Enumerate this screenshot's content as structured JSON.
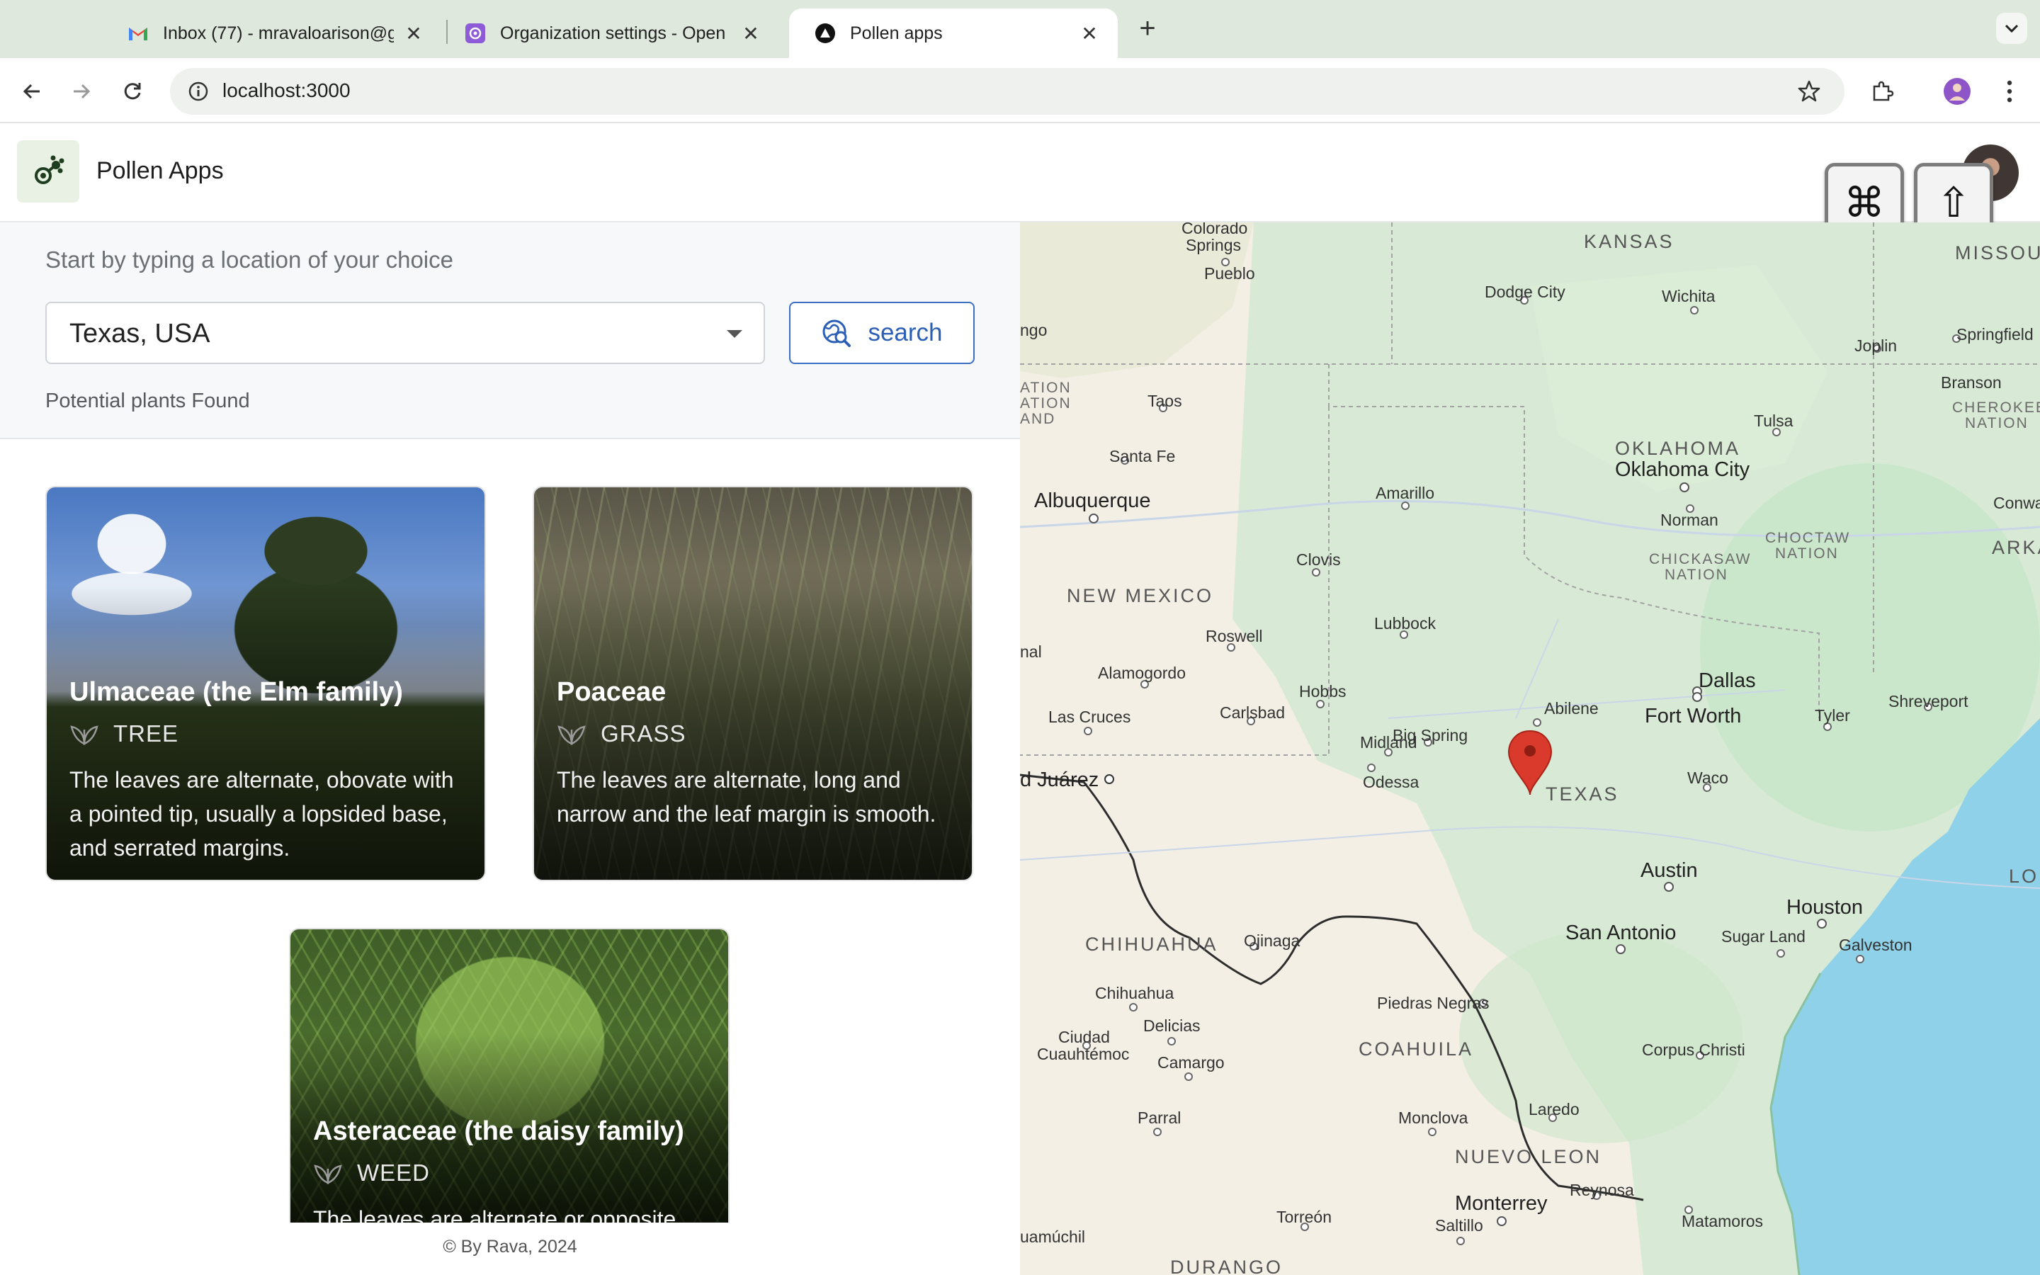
{
  "browser": {
    "tabs": [
      {
        "title": "Inbox (77) - mravaloarison@g",
        "icon": "gmail-icon"
      },
      {
        "title": "Organization settings - Open",
        "icon": "openai-icon"
      },
      {
        "title": "Pollen apps",
        "icon": "app-triangle-icon",
        "active": true
      }
    ],
    "url": "localhost:3000"
  },
  "app": {
    "name": "Pollen Apps",
    "keycaps": [
      "⌘",
      "⇧"
    ]
  },
  "search": {
    "prompt": "Start by typing a location of your choice",
    "location": "Texas, USA",
    "button_label": "search",
    "results_label": "Potential plants Found"
  },
  "plants": [
    {
      "name": "Ulmaceae (the Elm family)",
      "type": "TREE",
      "description": "The leaves are alternate, obovate with a pointed tip, usually a lopsided base, and serrated margins."
    },
    {
      "name": "Poaceae",
      "type": "GRASS",
      "description": "The leaves are alternate, long and narrow and the leaf margin is smooth."
    },
    {
      "name": "Asteraceae (the daisy family)",
      "type": "WEED",
      "description": "The leaves are alternate or opposite,"
    }
  ],
  "footer": "© By Rava, 2024",
  "map": {
    "states": [
      "KANSAS",
      "MISSOU",
      "OKLAHOMA",
      "NEW MEXICO",
      "TEXAS",
      "ARKANS",
      "LOU",
      "CHIHUAHUA",
      "COAHUILA",
      "NUEVO LEON",
      "DURANGO"
    ],
    "nations": [
      "ATION",
      "ATION",
      "AND",
      "CHEROKEE",
      "NATION",
      "CHICKASAW",
      "NATION",
      "CHOCTAW",
      "NATION"
    ],
    "cities_big": [
      "Albuquerque",
      "Oklahoma City",
      "Dallas",
      "Fort Worth",
      "Austin",
      "San Antonio",
      "Houston",
      "Monterrey"
    ],
    "cities": [
      "Colorado",
      "Springs",
      "Pueblo",
      "Dodge City",
      "Wichita",
      "Joplin",
      "Springfield",
      "Branson",
      "Taos",
      "Santa Fe",
      "Amarillo",
      "Tulsa",
      "Norman",
      "Conway",
      "Clovis",
      "Roswell",
      "Lubbock",
      "Alamogordo",
      "Hobbs",
      "Las Cruces",
      "Carlsbad",
      "Big Spring",
      "Midland",
      "Abilene",
      "Odessa",
      "Tyler",
      "Shreveport",
      "Waco",
      "Ojinaga",
      "Chihuahua",
      "Delicias",
      "Ciudad",
      "Cuauhtémoc",
      "Camargo",
      "Piedras Negras",
      "Sugar Land",
      "Galveston",
      "Parral",
      "Laredo",
      "Corpus Christi",
      "Monclova",
      "Reynosa",
      "Matamoros",
      "Torreón",
      "Saltillo",
      "uamúchil",
      "ngo",
      "nal",
      "d Juárez"
    ],
    "marker_icon": "map-pin-icon",
    "marker_color": "#d93a2b"
  }
}
